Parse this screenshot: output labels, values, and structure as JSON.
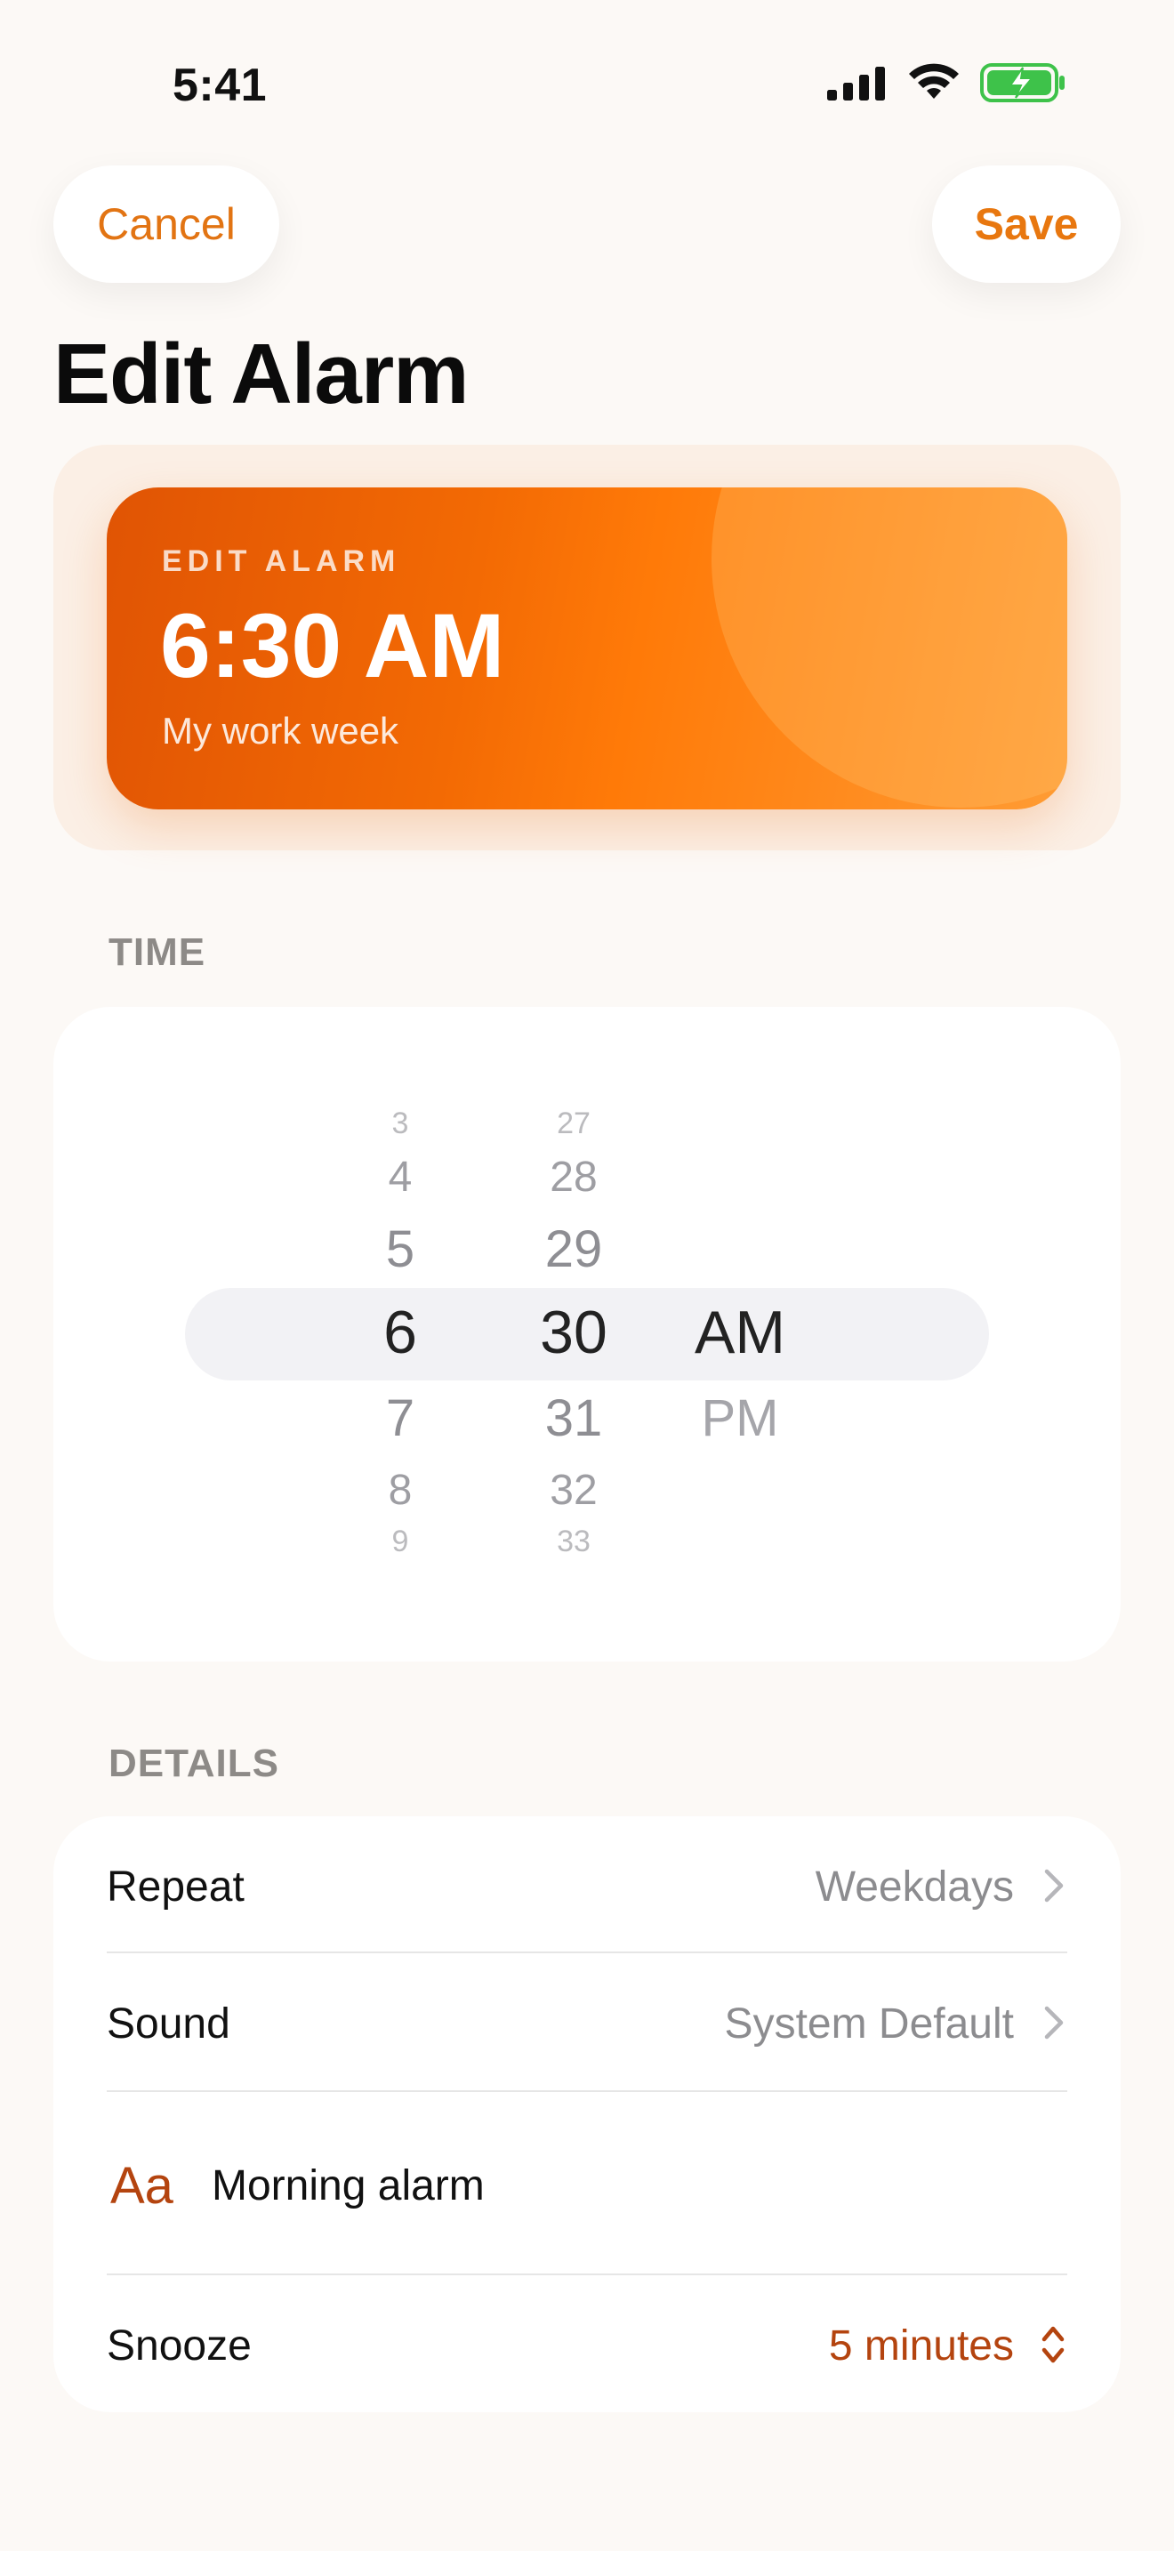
{
  "status_bar": {
    "time": "5:41",
    "icons": [
      "signal-icon",
      "wifi-icon",
      "battery-charging-icon"
    ]
  },
  "nav": {
    "cancel_label": "Cancel",
    "save_label": "Save"
  },
  "page_title": "Edit Alarm",
  "hero": {
    "kicker": "EDIT ALARM",
    "time": "6:30 AM",
    "subtitle": "My work week"
  },
  "sections": {
    "time_label": "TIME",
    "details_label": "DETAILS"
  },
  "picker": {
    "hours": [
      "3",
      "4",
      "5",
      "6",
      "7",
      "8",
      "9"
    ],
    "minutes": [
      "27",
      "28",
      "29",
      "30",
      "31",
      "32",
      "33"
    ],
    "periods": [
      "AM",
      "PM"
    ],
    "selected": {
      "hour": "6",
      "minute": "30",
      "period": "AM"
    }
  },
  "details": {
    "repeat": {
      "label": "Repeat",
      "value": "Weekdays"
    },
    "sound": {
      "label": "Sound",
      "value": "System Default"
    },
    "name": {
      "icon_text": "Aa",
      "value": "Morning alarm"
    },
    "snooze": {
      "label": "Snooze",
      "value": "5 minutes"
    }
  },
  "colors": {
    "accent": "#e8770f",
    "background": "#fcf9f6",
    "snooze_value": "#b4440f"
  }
}
